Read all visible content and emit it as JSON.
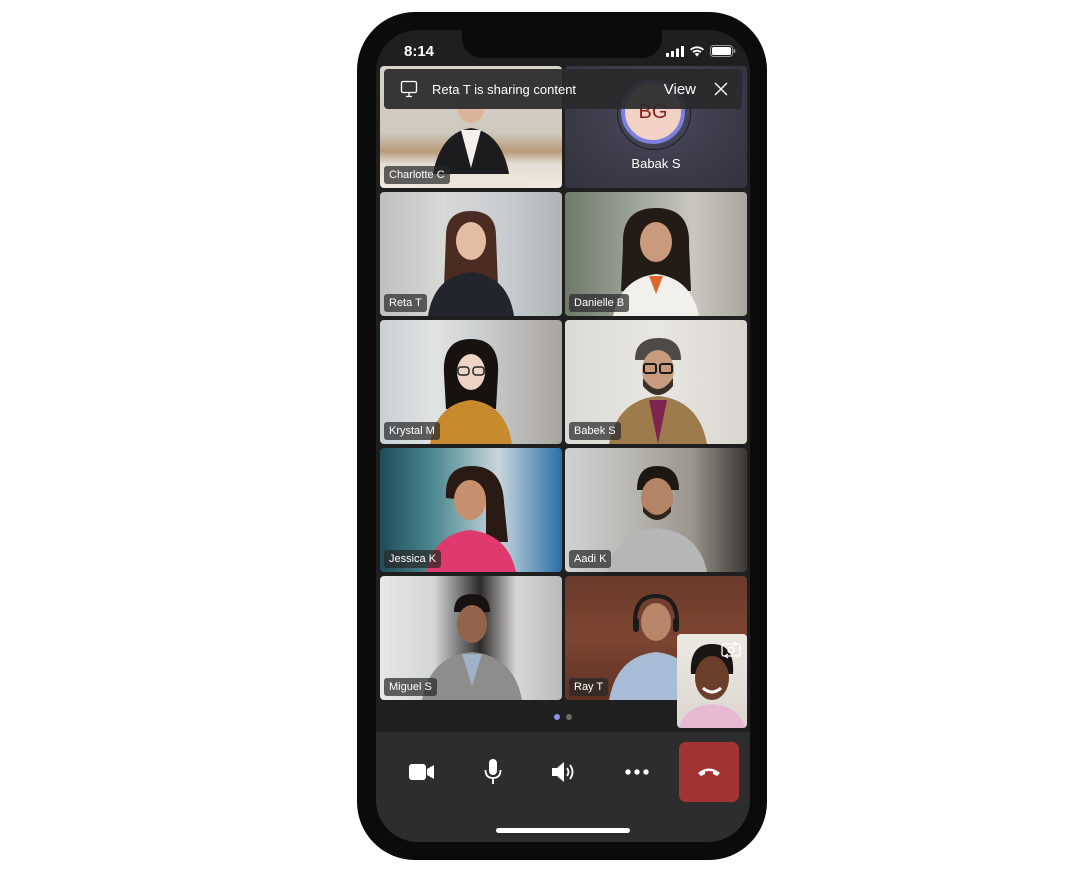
{
  "status_bar": {
    "time": "8:14",
    "icons": [
      "signal-icon",
      "wifi-icon",
      "battery-icon"
    ]
  },
  "banner": {
    "icon": "monitor-icon",
    "text": "Reta T is sharing content",
    "view_label": "View",
    "close_icon": "close-icon"
  },
  "participants": [
    {
      "name": "Charlotte C",
      "type": "video"
    },
    {
      "name": "Babak S",
      "type": "avatar",
      "initials": "BG"
    },
    {
      "name": "Reta T",
      "type": "video"
    },
    {
      "name": "Danielle B",
      "type": "video"
    },
    {
      "name": "Krystal M",
      "type": "video"
    },
    {
      "name": "Babek S",
      "type": "video"
    },
    {
      "name": "Jessica K",
      "type": "video"
    },
    {
      "name": "Aadi K",
      "type": "video"
    },
    {
      "name": "Miguel S",
      "type": "video"
    },
    {
      "name": "Ray T",
      "type": "video"
    }
  ],
  "pagination": {
    "current": 1,
    "total": 2
  },
  "self_view": {
    "icon": "switch-camera-icon"
  },
  "toolbar": {
    "buttons": [
      {
        "name": "camera",
        "icon": "video-camera-icon"
      },
      {
        "name": "microphone",
        "icon": "microphone-icon"
      },
      {
        "name": "speaker",
        "icon": "speaker-icon"
      },
      {
        "name": "more",
        "icon": "more-icon"
      },
      {
        "name": "hang-up",
        "icon": "hang-up-icon"
      }
    ]
  },
  "colors": {
    "accent": "#7b7fe0",
    "hangup": "#a33233",
    "avatar_bg": "#f3d2c6",
    "avatar_text": "#8c1d18",
    "toolbar_bg": "#2d2d2d",
    "screen_bg": "#1f1f1f",
    "dot_active": "#8e92ee",
    "dot_inactive": "#6b6b6b"
  }
}
